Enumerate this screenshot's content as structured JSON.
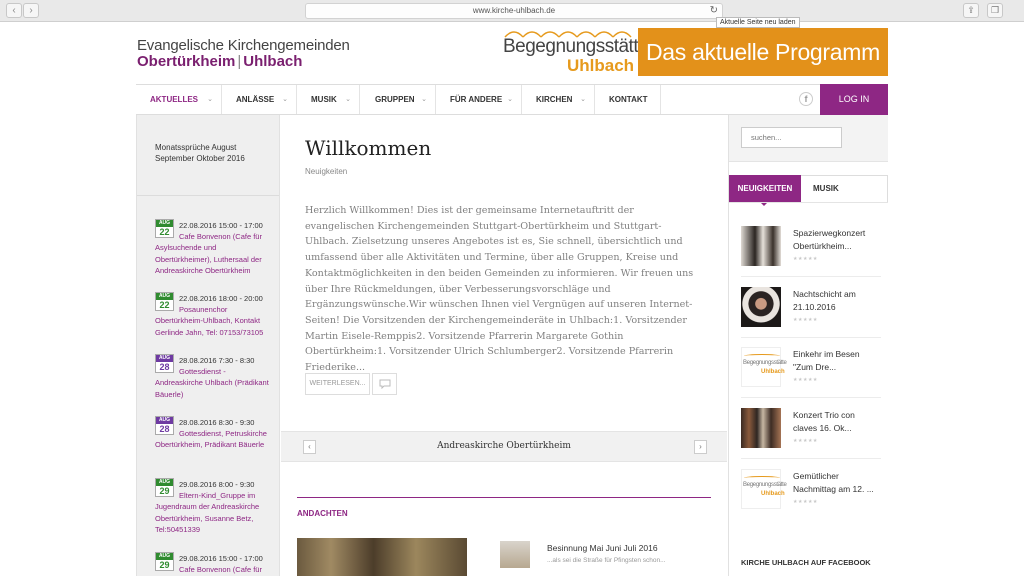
{
  "browser": {
    "url": "www.kirche-uhlbach.de",
    "reload_tooltip": "Aktuelle Seite neu laden"
  },
  "header": {
    "title": "Evangelische Kirchengemeinden",
    "place1": "Obertürkheim",
    "separator": "|",
    "place2": "Uhlbach",
    "logo_word": "Begegnungsstätte",
    "logo_place": "Uhlbach",
    "banner": "Das aktuelle Programm"
  },
  "nav": {
    "items": [
      "AKTUELLES",
      "ANLÄSSE",
      "MUSIK",
      "GRUPPEN",
      "FÜR ANDERE",
      "KIRCHEN",
      "KONTAKT"
    ],
    "facebook": "f",
    "login": "LOG IN"
  },
  "left": {
    "verse": "Monatssprüche August September Oktober 2016",
    "events": [
      {
        "month": "AUG",
        "day": "22",
        "color": "green",
        "time": "22.08.2016 15:00 - 17:00",
        "title": "Cafe Bonvenon (Cafe für Asylsuchende und Obertürkheimer), Luthersaal der Andreaskirche Obertürkheim"
      },
      {
        "month": "AUG",
        "day": "22",
        "color": "green",
        "time": "22.08.2016 18:00 - 20:00",
        "title": "Posaunenchor Obertürkheim-Uhlbach, Kontakt Gerlinde Jahn, Tel: 07153/73105"
      },
      {
        "month": "AUG",
        "day": "28",
        "color": "purple",
        "time": "28.08.2016 7:30 - 8:30",
        "title": "Gottesdienst - Andreaskirche Uhlbach (Prädikant Bäuerle)"
      },
      {
        "month": "AUG",
        "day": "28",
        "color": "purple",
        "time": "28.08.2016 8:30 - 9:30",
        "title": "Gottesdienst, Petruskirche Obertürkheim, Prädikant Bäuerle"
      },
      {
        "month": "AUG",
        "day": "29",
        "color": "green",
        "time": "29.08.2016 8:00 - 9:30",
        "title": "Eltern-Kind_Gruppe im Jugendraum der Andreaskirche Obertürkheim, Susanne Betz, Tel:50451339"
      },
      {
        "month": "AUG",
        "day": "29",
        "color": "green",
        "time": "29.08.2016 15:00 - 17:00",
        "title": "Cafe Bonvenon (Cafe für"
      }
    ]
  },
  "main": {
    "title": "Willkommen",
    "category": "Neuigkeiten",
    "intro": "Herzlich Willkommen! Dies ist der gemeinsame Internetauftritt der evangelischen Kirchengemeinden Stuttgart-Obertürkheim und Stuttgart-Uhlbach. Zielsetzung unseres Angebotes ist es, Sie schnell, übersichtlich und umfassend über alle Aktivitäten und Termine, über alle Gruppen, Kreise und Kontaktmöglichkeiten in den beiden Gemeinden zu informieren. Wir freuen uns über Ihre Rückmeldungen, über Verbesserungsvorschläge und Ergänzungswünsche.Wir wünschen Ihnen viel Vergnügen auf unseren Internet-Seiten! Die Vorsitzenden der Kirchengemeinderäte in Uhlbach:1. Vorsitzender Martin Eisele-Remppis2. Vorsitzende Pfarrerin Margarete Gothin Obertürkheim:1. Vorsitzender Ulrich Schlumberger2. Vorsitzende Pfarrerin Friederike...",
    "read_more": "WEITERLESEN...",
    "slider_title": "Andreaskirche Obertürkheim",
    "slider_prev": "‹",
    "slider_next": "›",
    "section": "ANDACHTEN",
    "andacht_title": "Besinnung Mai Juni Juli 2016",
    "andacht_sub": "...als sei die Straße für Pfingsten schon..."
  },
  "right": {
    "search_placeholder": "suchen...",
    "tab_news": "NEUIGKEITEN",
    "tab_music": "MUSIK",
    "news": [
      {
        "title": "Spazierwegkonzert Obertürkheim...",
        "thumb": "photo-group"
      },
      {
        "title": "Nachtschicht am 21.10.2016",
        "thumb": "photo-portrait"
      },
      {
        "title": "Einkehr im Besen \"Zum Dre...",
        "thumb": "logo"
      },
      {
        "title": "Konzert Trio con claves 16. Ok...",
        "thumb": "photo-trio"
      },
      {
        "title": "Gemütlicher Nachmittag am 12. ...",
        "thumb": "logo"
      }
    ],
    "stars": "★★★★★",
    "facebook_title": "KIRCHE UHLBACH AUF FACEBOOK",
    "logo_small_word": "Begegnungsstätte",
    "logo_small_place": "Uhlbach"
  },
  "colors": {
    "brand": "#8e2784",
    "accent": "#e3911a"
  }
}
